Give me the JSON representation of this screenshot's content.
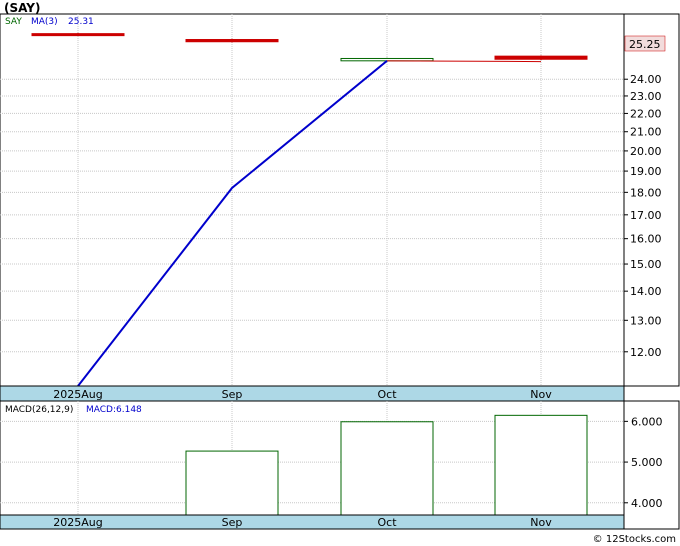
{
  "colors": {
    "price_axis_bg": "#ffffff",
    "date_axis_bg": "#add8e6",
    "ma_line": "#0000cc",
    "candle_down": "#cc0000",
    "candle_up": "#006600",
    "macd_bar": "#006600",
    "price_tag_bg": "#f2dcdc",
    "grid": "#c8c8c8"
  },
  "chart_data": [
    {
      "type": "line",
      "title": "(SAY)",
      "legend": {
        "symbol": "SAY",
        "ma_label": "MA(3)",
        "ma_value": "25.31"
      },
      "price_tag": "25.25",
      "x_labels": [
        "2025Aug",
        "Sep",
        "Oct",
        "Nov"
      ],
      "y_ticks": [
        12,
        13,
        14,
        15,
        16,
        17,
        18,
        19,
        20,
        21,
        22,
        23,
        24
      ],
      "y_tick_labels": [
        "12.00",
        "13.00",
        "14.00",
        "15.00",
        "16.00",
        "17.00",
        "18.00",
        "19.00",
        "20.00",
        "21.00",
        "22.00",
        "23.00",
        "24.00"
      ],
      "ylim": [
        11.0,
        27.2
      ],
      "log_scale": true,
      "grid": true,
      "series": [
        {
          "name": "MA(3)",
          "x": [
            "2025Aug",
            "Sep",
            "Oct"
          ],
          "values": [
            11.0,
            18.2,
            25.15
          ]
        }
      ],
      "candles": [
        {
          "x": "2025Aug",
          "open": 26.95,
          "high": 27.0,
          "low": 26.8,
          "close": 26.85,
          "dir": "down"
        },
        {
          "x": "Sep",
          "open": 26.55,
          "high": 26.6,
          "low": 26.35,
          "close": 26.4,
          "dir": "down"
        },
        {
          "x": "Oct",
          "open": 25.15,
          "high": 25.35,
          "low": 25.15,
          "close": 25.3,
          "dir": "up"
        },
        {
          "x": "Nov",
          "open": 25.45,
          "high": 25.5,
          "low": 25.2,
          "close": 25.25,
          "dir": "down"
        }
      ]
    },
    {
      "type": "bar",
      "legend": {
        "label": "MACD(26,12,9)",
        "macd_label": "MACD:6.148"
      },
      "x_labels": [
        "2025Aug",
        "Sep",
        "Oct",
        "Nov"
      ],
      "y_ticks": [
        4,
        5,
        6
      ],
      "y_tick_labels": [
        "4.000",
        "5.000",
        "6.000"
      ],
      "ylim": [
        3.7,
        6.5
      ],
      "categories": [
        "Sep",
        "Oct",
        "Nov"
      ],
      "values": [
        5.27,
        5.99,
        6.148
      ]
    }
  ],
  "watermark": "© 12Stocks.com"
}
